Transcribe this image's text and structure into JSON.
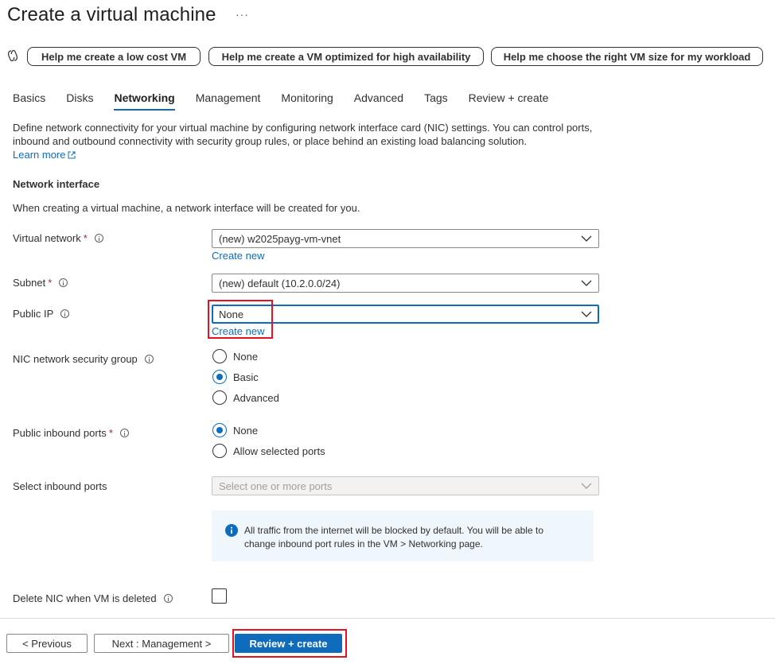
{
  "page": {
    "title": "Create a virtual machine",
    "more": "···"
  },
  "assist": {
    "low_cost": "Help me create a low cost VM",
    "high_availability": "Help me create a VM optimized for high availability",
    "vm_size": "Help me choose the right VM size for my workload"
  },
  "tabs": [
    {
      "label": "Basics"
    },
    {
      "label": "Disks"
    },
    {
      "label": "Networking",
      "active": true
    },
    {
      "label": "Management"
    },
    {
      "label": "Monitoring"
    },
    {
      "label": "Advanced"
    },
    {
      "label": "Tags"
    },
    {
      "label": "Review + create"
    }
  ],
  "intro": {
    "line1": "Define network connectivity for your virtual machine by configuring network interface card (NIC) settings. You can control ports,",
    "line2": "inbound and outbound connectivity with security group rules, or place behind an existing load balancing solution.",
    "learn_more": "Learn more"
  },
  "network_interface": {
    "title": "Network interface",
    "description": "When creating a virtual machine, a network interface will be created for you."
  },
  "fields": {
    "virtual_network": {
      "label": "Virtual network",
      "required": "*",
      "value": "(new) w2025payg-vm-vnet",
      "create_new": "Create new"
    },
    "subnet": {
      "label": "Subnet",
      "required": "*",
      "value": "(new) default (10.2.0.0/24)"
    },
    "public_ip": {
      "label": "Public IP",
      "value": "None",
      "create_new": "Create new"
    },
    "nic_nsg": {
      "label": "NIC network security group",
      "options": [
        "None",
        "Basic",
        "Advanced"
      ],
      "selected": "Basic"
    },
    "public_inbound_ports": {
      "label": "Public inbound ports",
      "required": "*",
      "options": [
        "None",
        "Allow selected ports"
      ],
      "selected": "None"
    },
    "select_inbound_ports": {
      "label": "Select inbound ports",
      "placeholder": "Select one or more ports"
    },
    "info_message": {
      "line1": "All traffic from the internet will be blocked by default. You will be able to",
      "line2": "change inbound port rules in the VM > Networking page."
    },
    "delete_nic": {
      "label": "Delete NIC when VM is deleted",
      "checked": false
    }
  },
  "footer": {
    "previous": "< Previous",
    "next": "Next : Management >",
    "review_create": "Review + create"
  },
  "colors": {
    "accent": "#0f6cbd",
    "required": "#a4262c",
    "highlight": "#e81123",
    "info_bg": "#eff6fc"
  }
}
